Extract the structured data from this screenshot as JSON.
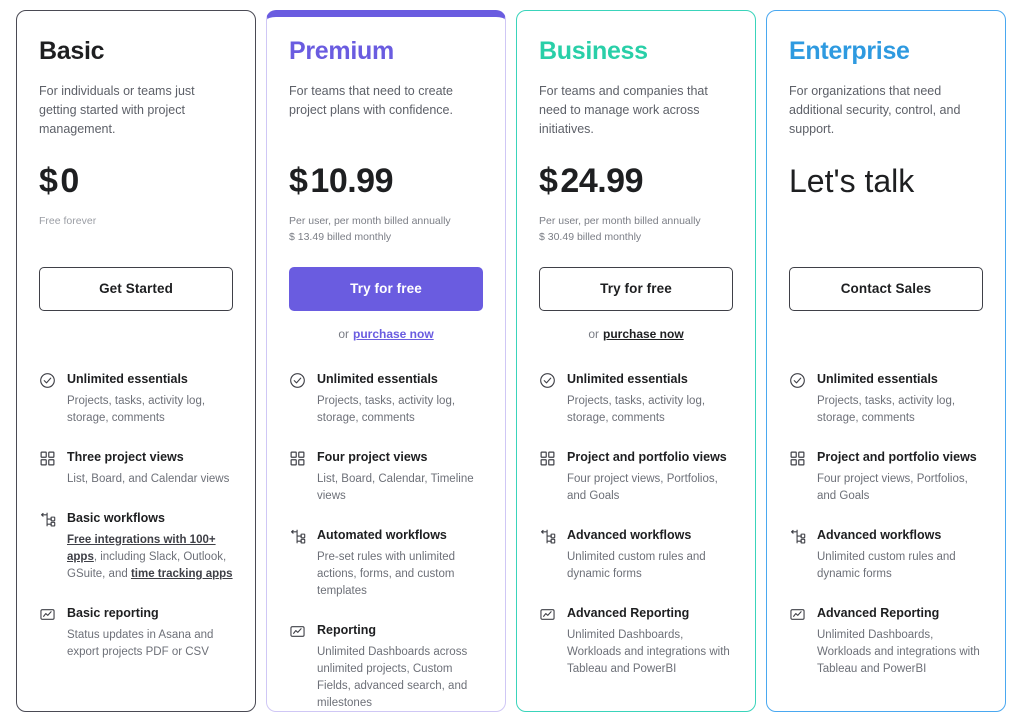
{
  "plans": [
    {
      "id": "basic",
      "name": "Basic",
      "tagline": "For individuals or teams just getting started with project management.",
      "currency": "$",
      "price": "0",
      "billing_primary": "Free forever",
      "billing_secondary": "",
      "cta_label": "Get Started",
      "cta_style": "outline",
      "purchase_prefix": "or",
      "purchase_label": "purchase now",
      "show_purchase": false,
      "accent": "#1e1f21",
      "features": [
        {
          "icon": "check-circle-icon",
          "title": "Unlimited essentials",
          "desc": "Projects, tasks, activity log, storage, comments"
        },
        {
          "icon": "grid-squares-icon",
          "title": "Three project views",
          "desc": "List, Board, and Calendar views"
        },
        {
          "icon": "workflow-branch-icon",
          "title": "Basic workflows",
          "desc_parts": [
            {
              "text": "Free integrations with 100+ apps",
              "underline": true
            },
            {
              "text": ", including Slack, Outlook, GSuite, and ",
              "underline": false
            },
            {
              "text": "time tracking apps",
              "underline": true
            }
          ]
        },
        {
          "icon": "report-chart-icon",
          "title": "Basic reporting",
          "desc": "Status updates in Asana and export projects PDF or CSV"
        }
      ]
    },
    {
      "id": "premium",
      "name": "Premium",
      "tagline": "For teams that need to create project plans with confidence.",
      "currency": "$",
      "price": "10.99",
      "billing_primary": "Per user, per month billed annually",
      "billing_secondary": "$ 13.49 billed monthly",
      "cta_label": "Try for free",
      "cta_style": "filled",
      "purchase_prefix": "or",
      "purchase_label": "purchase now",
      "show_purchase": true,
      "accent": "#6a5ce0",
      "features": [
        {
          "icon": "check-circle-icon",
          "title": "Unlimited essentials",
          "desc": "Projects, tasks, activity log, storage, comments"
        },
        {
          "icon": "grid-squares-icon",
          "title": "Four project views",
          "desc": "List, Board, Calendar, Timeline views"
        },
        {
          "icon": "workflow-branch-icon",
          "title": "Automated workflows",
          "desc": "Pre-set rules with unlimited actions, forms, and custom templates"
        },
        {
          "icon": "report-chart-icon",
          "title": "Reporting",
          "desc": "Unlimited Dashboards across unlimited projects, Custom Fields, advanced search, and milestones"
        }
      ]
    },
    {
      "id": "business",
      "name": "Business",
      "tagline": "For teams and companies that need to manage work across initiatives.",
      "currency": "$",
      "price": "24.99",
      "billing_primary": "Per user, per month billed annually",
      "billing_secondary": "$ 30.49 billed monthly",
      "cta_label": "Try for free",
      "cta_style": "outline",
      "purchase_prefix": "or",
      "purchase_label": "purchase now",
      "show_purchase": true,
      "accent": "#29cfa8",
      "features": [
        {
          "icon": "check-circle-icon",
          "title": "Unlimited essentials",
          "desc": "Projects, tasks, activity log, storage, comments"
        },
        {
          "icon": "grid-squares-icon",
          "title": "Project and portfolio views",
          "desc": "Four project views, Portfolios, and Goals"
        },
        {
          "icon": "workflow-branch-icon",
          "title": "Advanced workflows",
          "desc": "Unlimited custom rules and dynamic forms"
        },
        {
          "icon": "report-chart-icon",
          "title": "Advanced Reporting",
          "desc": "Unlimited Dashboards, Workloads and integrations with Tableau and PowerBI"
        }
      ]
    },
    {
      "id": "enterprise",
      "name": "Enterprise",
      "tagline": "For organizations that need additional security, control, and support.",
      "currency": "",
      "price": "Let's talk",
      "billing_primary": "",
      "billing_secondary": "",
      "cta_label": "Contact Sales",
      "cta_style": "outline",
      "purchase_prefix": "or",
      "purchase_label": "purchase now",
      "show_purchase": false,
      "accent": "#2e9ae0",
      "features": [
        {
          "icon": "check-circle-icon",
          "title": "Unlimited essentials",
          "desc": "Projects, tasks, activity log, storage, comments"
        },
        {
          "icon": "grid-squares-icon",
          "title": "Project and portfolio views",
          "desc": "Four project views, Portfolios, and Goals"
        },
        {
          "icon": "workflow-branch-icon",
          "title": "Advanced workflows",
          "desc": "Unlimited custom rules and dynamic forms"
        },
        {
          "icon": "report-chart-icon",
          "title": "Advanced Reporting",
          "desc": "Unlimited Dashboards, Workloads and integrations with Tableau and PowerBI"
        }
      ]
    }
  ],
  "colors": {
    "basic_border": "#4a4a54",
    "premium_border": "#6a5ce0",
    "business_border": "#3ad4bb",
    "enterprise_border": "#4aa8f0",
    "premium_fill": "#6a5ce0",
    "text_dark": "#1e1f21",
    "text_muted": "#6d7078"
  }
}
